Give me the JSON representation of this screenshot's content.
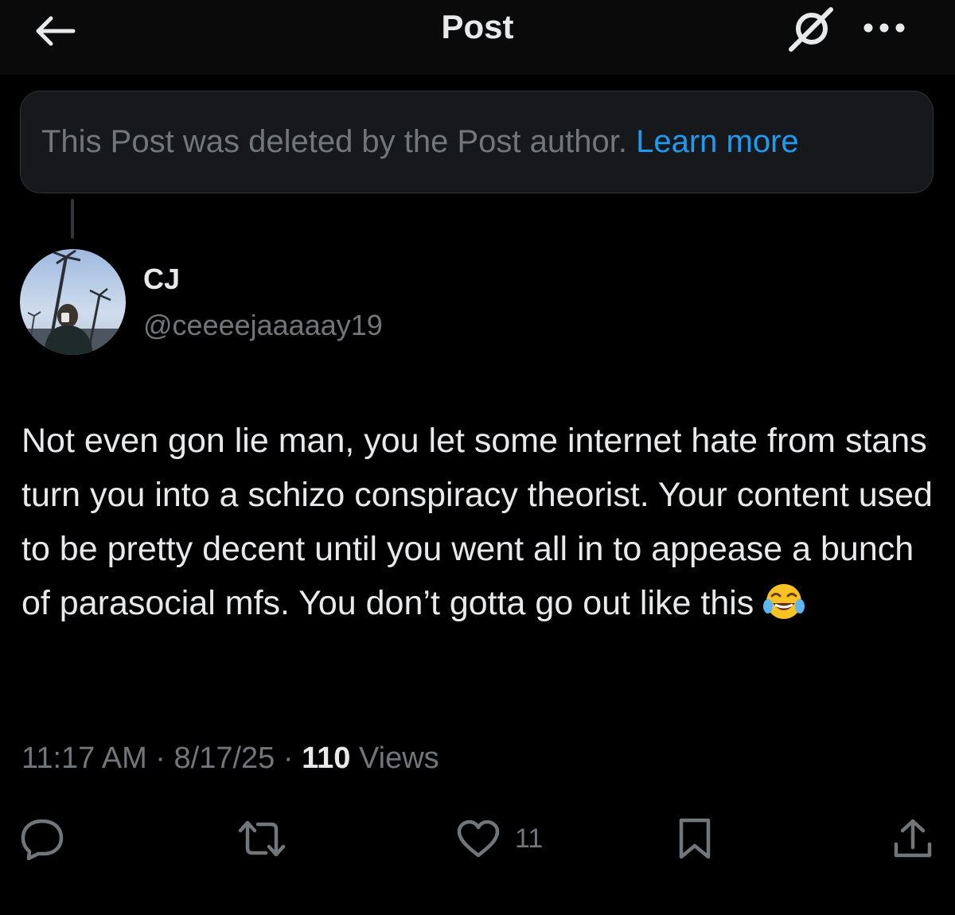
{
  "header": {
    "title": "Post",
    "back_icon": "arrow-left-icon",
    "grok_icon": "grok-icon",
    "more_icon": "more-dots-icon"
  },
  "deleted_notice": {
    "text": "This Post was deleted by the Post author. ",
    "link": "Learn more"
  },
  "author": {
    "display_name": "CJ",
    "handle": "@ceeeejaaaaay19",
    "avatar_icon": "avatar-photo"
  },
  "post": {
    "text": "Not even gon lie man, you let some internet hate from stans turn you into a schizo conspiracy theorist. Your content used to be pretty decent until you went all in to appease a bunch of parasocial mfs. You don’t gotta go out like this",
    "emoji_icon": "face-with-tears-of-joy-icon"
  },
  "meta": {
    "time": "11:17 AM",
    "separator": "·",
    "date": "8/17/25",
    "views_count": "110",
    "views_label": "Views"
  },
  "actions": {
    "reply_icon": "reply-icon",
    "repost_icon": "repost-icon",
    "like_icon": "heart-icon",
    "like_count": "11",
    "bookmark_icon": "bookmark-icon",
    "share_icon": "share-icon"
  },
  "colors": {
    "background": "#000000",
    "text": "#e7e9ea",
    "secondary": "#71767b",
    "accent": "#1d9bf0",
    "notice_bg": "#16181c"
  }
}
